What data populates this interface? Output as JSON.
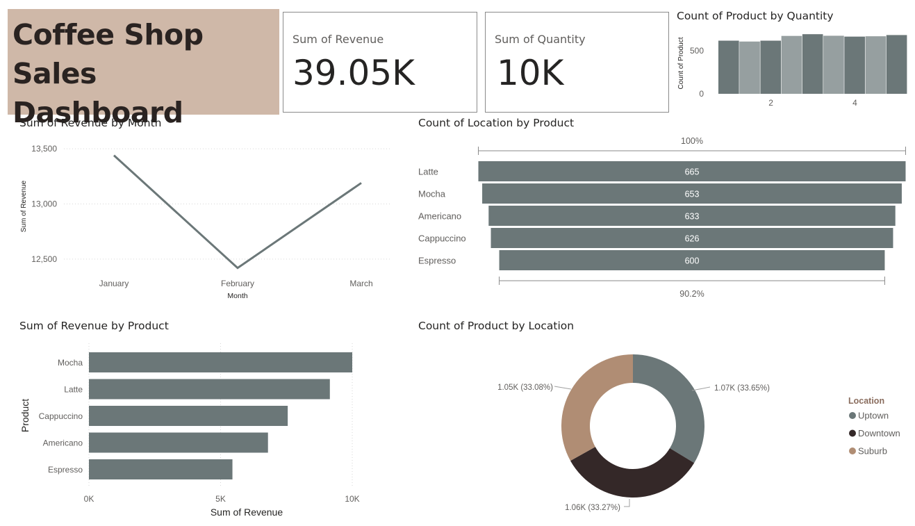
{
  "dashboard": {
    "title_line1": "Coffee Shop",
    "title_line2": "Sales Dashboard"
  },
  "cards": [
    {
      "label": "Sum of Revenue",
      "value": "39.05K"
    },
    {
      "label": "Sum of Quantity",
      "value": "10K"
    }
  ],
  "colors": {
    "primary": "#6b7778",
    "light": "#969fa0",
    "dark": "#342828",
    "tan": "#b08d74",
    "title_bg": "#cfb8a8"
  },
  "chart_data": [
    {
      "id": "quantity",
      "type": "bar",
      "title": "Count of Product by Quantity",
      "ylabel": "Count of Product",
      "x_ticks": [
        "2",
        "4"
      ],
      "y_ticks": [
        "0",
        "500"
      ],
      "ylim": [
        0,
        780
      ],
      "x": [
        1,
        1.5,
        2,
        2.5,
        3,
        3.5,
        4,
        4.5,
        5
      ],
      "values": [
        615,
        605,
        615,
        670,
        690,
        672,
        662,
        666,
        680
      ],
      "shades": [
        "primary",
        "light",
        "primary",
        "light",
        "primary",
        "light",
        "primary",
        "light",
        "primary"
      ]
    },
    {
      "id": "month",
      "type": "line",
      "title": "Sum of Revenue by Month",
      "xlabel": "Month",
      "ylabel": "Sum of Revenue",
      "categories": [
        "January",
        "February",
        "March"
      ],
      "values": [
        13440,
        12420,
        13190
      ],
      "y_ticks": [
        "13,500",
        "13,000",
        "12,500"
      ],
      "y_tick_values": [
        13500,
        13000,
        12500
      ],
      "ylim": [
        12380,
        13620
      ]
    },
    {
      "id": "funnel",
      "type": "bar",
      "title": "Count of Location by Product",
      "categories": [
        "Latte",
        "Mocha",
        "Americano",
        "Cappuccino",
        "Espresso"
      ],
      "values": [
        665,
        653,
        633,
        626,
        600
      ],
      "value_labels": [
        "665",
        "653",
        "633",
        "626",
        "600"
      ],
      "top_percent": "100%",
      "bottom_percent": "90.2%"
    },
    {
      "id": "product_revenue",
      "type": "bar",
      "title": "Sum of Revenue by Product",
      "xlabel": "Sum of Revenue",
      "ylabel": "Product",
      "categories": [
        "Mocha",
        "Latte",
        "Cappuccino",
        "Americano",
        "Espresso"
      ],
      "values": [
        10000,
        9150,
        7550,
        6800,
        5450
      ],
      "x_ticks": [
        "0K",
        "5K",
        "10K"
      ],
      "x_tick_values": [
        0,
        5000,
        10000
      ],
      "xlim": [
        0,
        10000
      ]
    },
    {
      "id": "location",
      "type": "pie",
      "title": "Count of Product by Location",
      "legend_title": "Location",
      "labels": [
        "Uptown",
        "Downtown",
        "Suburb"
      ],
      "values": [
        33.65,
        33.27,
        33.08
      ],
      "value_labels": [
        "1.07K (33.65%)",
        "1.06K (33.27%)",
        "1.05K (33.08%)"
      ],
      "slice_colors": [
        "primary",
        "dark",
        "tan"
      ],
      "legend_position": "right"
    }
  ]
}
